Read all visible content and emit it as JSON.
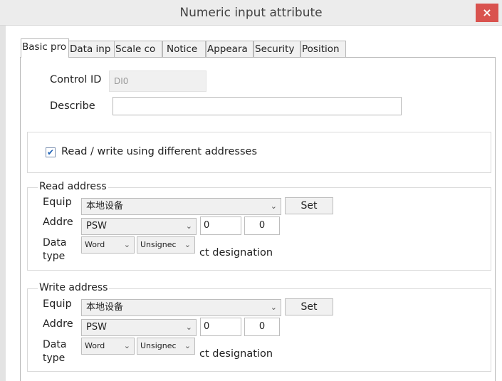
{
  "window": {
    "title": "Numeric input attribute",
    "close_symbol": "×"
  },
  "tabs": [
    {
      "label": "Basic pro",
      "active": true
    },
    {
      "label": "Data inp",
      "active": false
    },
    {
      "label": "Scale co",
      "active": false
    },
    {
      "label": "Notice",
      "active": false
    },
    {
      "label": "Appeara",
      "active": false
    },
    {
      "label": "Security",
      "active": false
    },
    {
      "label": "Position",
      "active": false
    }
  ],
  "basic": {
    "control_id_label": "Control ID",
    "control_id_value": "DI0",
    "describe_label": "Describe",
    "describe_value": ""
  },
  "rw_option": {
    "checked": true,
    "label": "Read / write using different addresses"
  },
  "read_address": {
    "legend": "Read address",
    "equip_label": "Equip",
    "equip_value": "本地设备",
    "set_label": "Set",
    "addr_label": "Addre",
    "addr_value": "PSW",
    "num1": "0",
    "num2": "0",
    "data_label_1": "Data",
    "data_label_2": "type",
    "type1": "Word",
    "type2": "Unsignec",
    "designation": "ct designation"
  },
  "write_address": {
    "legend": "Write address",
    "equip_label": "Equip",
    "equip_value": "本地设备",
    "set_label": "Set",
    "addr_label": "Addre",
    "addr_value": "PSW",
    "num1": "0",
    "num2": "0",
    "data_label_1": "Data",
    "data_label_2": "type",
    "type1": "Word",
    "type2": "Unsignec",
    "designation": "ct designation"
  },
  "icons": {
    "chevron": "⌄",
    "check": "✔"
  },
  "colors": {
    "close": "#d9534f",
    "check": "#1a5fb4"
  }
}
